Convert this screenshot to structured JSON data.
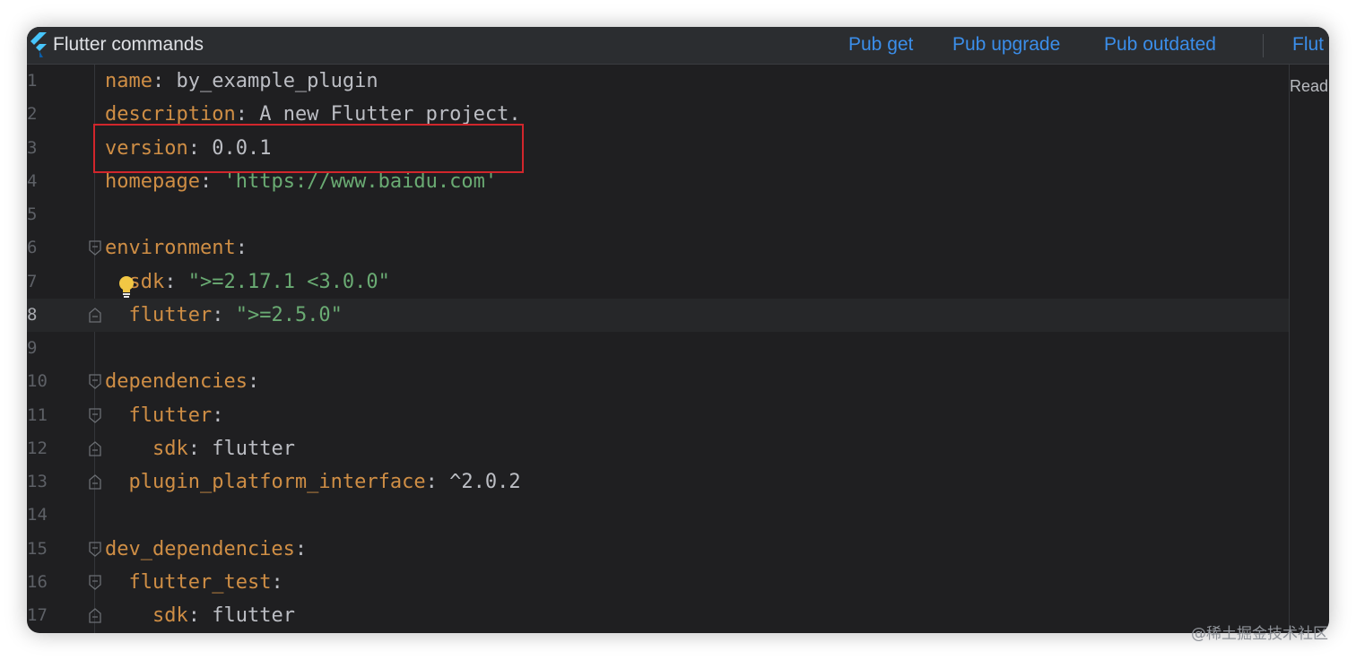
{
  "toolbar": {
    "title": "Flutter commands",
    "commands": [
      "Pub get",
      "Pub upgrade",
      "Pub outdated"
    ],
    "cut_command": "Flut",
    "icon": "flutter-logo-icon"
  },
  "side_panel": {
    "label": "Read"
  },
  "editor": {
    "current_line": "8",
    "lines": [
      {
        "ln": "1",
        "key": "name",
        "value": "by_example_plugin",
        "vtype": "plain"
      },
      {
        "ln": "2",
        "key": "description",
        "value": "A new Flutter project.",
        "vtype": "plain"
      },
      {
        "ln": "3",
        "key": "version",
        "value": "0.0.1",
        "vtype": "plain"
      },
      {
        "ln": "4",
        "key": "homepage",
        "value": "'https://www.baidu.com'",
        "vtype": "string"
      },
      {
        "ln": "5",
        "key": "",
        "value": "",
        "vtype": "plain"
      },
      {
        "ln": "6",
        "key": "environment",
        "value": "",
        "vtype": "plain"
      },
      {
        "ln": "7",
        "key": "sdk",
        "value": "\">=2.17.1 <3.0.0\"",
        "vtype": "string"
      },
      {
        "ln": "8",
        "key": "flutter",
        "value": "\">=2.5.0\"",
        "vtype": "string"
      },
      {
        "ln": "9",
        "key": "",
        "value": "",
        "vtype": "plain"
      },
      {
        "ln": "10",
        "key": "dependencies",
        "value": "",
        "vtype": "plain"
      },
      {
        "ln": "11",
        "key": "flutter",
        "value": "",
        "vtype": "plain"
      },
      {
        "ln": "12",
        "key": "sdk",
        "value": "flutter",
        "vtype": "plain"
      },
      {
        "ln": "13",
        "key": "plugin_platform_interface",
        "value": "^2.0.2",
        "vtype": "plain"
      },
      {
        "ln": "14",
        "key": "",
        "value": "",
        "vtype": "plain"
      },
      {
        "ln": "15",
        "key": "dev_dependencies",
        "value": "",
        "vtype": "plain"
      },
      {
        "ln": "16",
        "key": "flutter_test",
        "value": "",
        "vtype": "plain"
      },
      {
        "ln": "17",
        "key": "sdk",
        "value": "flutter",
        "vtype": "plain"
      }
    ]
  },
  "watermark": "@稀土掘金技术社区",
  "colors": {
    "key": "#cf8e45",
    "string": "#6aab73",
    "command": "#3b8eea",
    "highlight_box": "#d1262c"
  }
}
